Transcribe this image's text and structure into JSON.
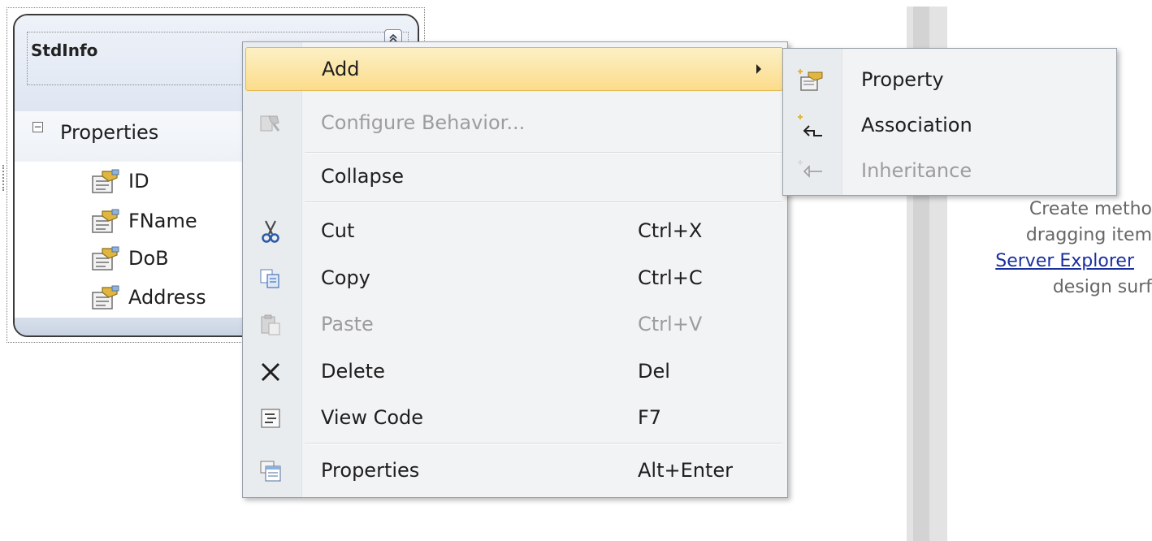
{
  "entity": {
    "title": "StdInfo",
    "section_label": "Properties",
    "properties": [
      {
        "label": "ID",
        "icon": "property-icon"
      },
      {
        "label": "FName",
        "icon": "property-icon"
      },
      {
        "label": "DoB",
        "icon": "property-icon"
      },
      {
        "label": "Address",
        "icon": "property-icon"
      }
    ]
  },
  "context_menu": {
    "items": [
      {
        "label": "Add",
        "shortcut": "",
        "icon": "",
        "state": "highlighted",
        "has_submenu": true
      },
      {
        "label": "Configure Behavior...",
        "shortcut": "",
        "icon": "configure-behavior-icon",
        "state": "disabled"
      },
      {
        "label": "Collapse",
        "shortcut": "",
        "icon": "",
        "state": "enabled"
      },
      {
        "label": "Cut",
        "shortcut": "Ctrl+X",
        "icon": "scissors-icon",
        "state": "enabled"
      },
      {
        "label": "Copy",
        "shortcut": "Ctrl+C",
        "icon": "copy-icon",
        "state": "enabled"
      },
      {
        "label": "Paste",
        "shortcut": "Ctrl+V",
        "icon": "paste-icon",
        "state": "disabled"
      },
      {
        "label": "Delete",
        "shortcut": "Del",
        "icon": "delete-x-icon",
        "state": "enabled"
      },
      {
        "label": "View Code",
        "shortcut": "F7",
        "icon": "view-code-icon",
        "state": "enabled"
      },
      {
        "label": "Properties",
        "shortcut": "Alt+Enter",
        "icon": "properties-window-icon",
        "state": "enabled"
      }
    ]
  },
  "submenu": {
    "items": [
      {
        "label": "Property",
        "icon": "add-property-icon",
        "state": "enabled"
      },
      {
        "label": "Association",
        "icon": "add-association-icon",
        "state": "enabled"
      },
      {
        "label": "Inheritance",
        "icon": "add-inheritance-icon",
        "state": "disabled"
      }
    ]
  },
  "help_panel": {
    "line1": "Create metho",
    "line2": "dragging item",
    "line3_link": "Server Explorer",
    "line4": "design surf"
  },
  "colors": {
    "menu_background": "#f2f3f5",
    "highlight_top": "#fdf0c6",
    "highlight_bottom": "#fbdc8a",
    "highlight_border": "#e2b84f",
    "disabled_text": "#9d9d9d",
    "link": "#1a2f9e"
  }
}
